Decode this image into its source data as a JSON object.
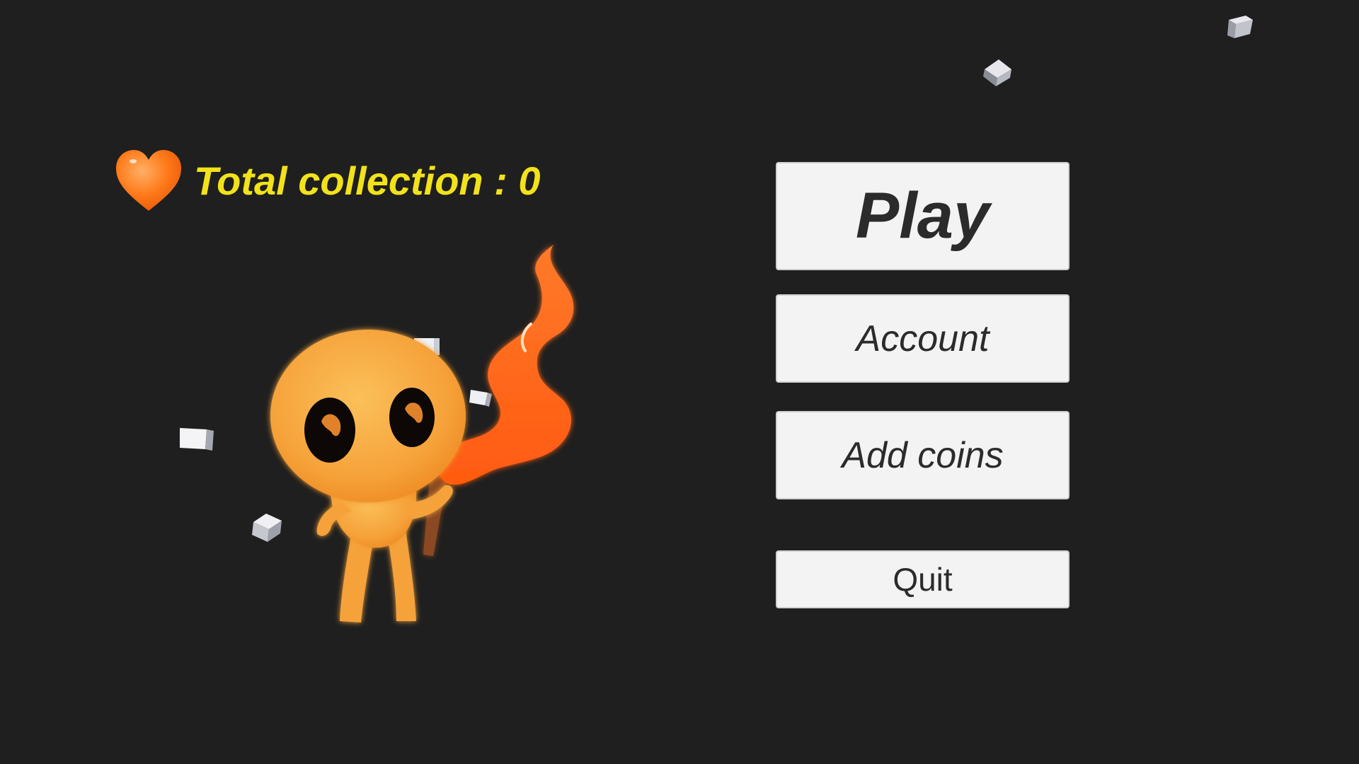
{
  "hud": {
    "collection_label": "Total collection",
    "collection_separator": " : ",
    "collection_count": "0",
    "heart_icon": "heart-icon",
    "heart_color": "#ff7a1a",
    "text_color": "#f2e21a"
  },
  "menu": {
    "play_label": "Play",
    "account_label": "Account",
    "add_coins_label": "Add coins",
    "quit_label": "Quit"
  },
  "colors": {
    "background": "#1f1f1f",
    "button_bg": "#f3f3f3",
    "button_text": "#2b2b2b",
    "character_body": "#f6a23a",
    "flame": "#ff6a1e"
  },
  "scene": {
    "character": "character-illustration",
    "cube_icon": "cube-icon"
  }
}
